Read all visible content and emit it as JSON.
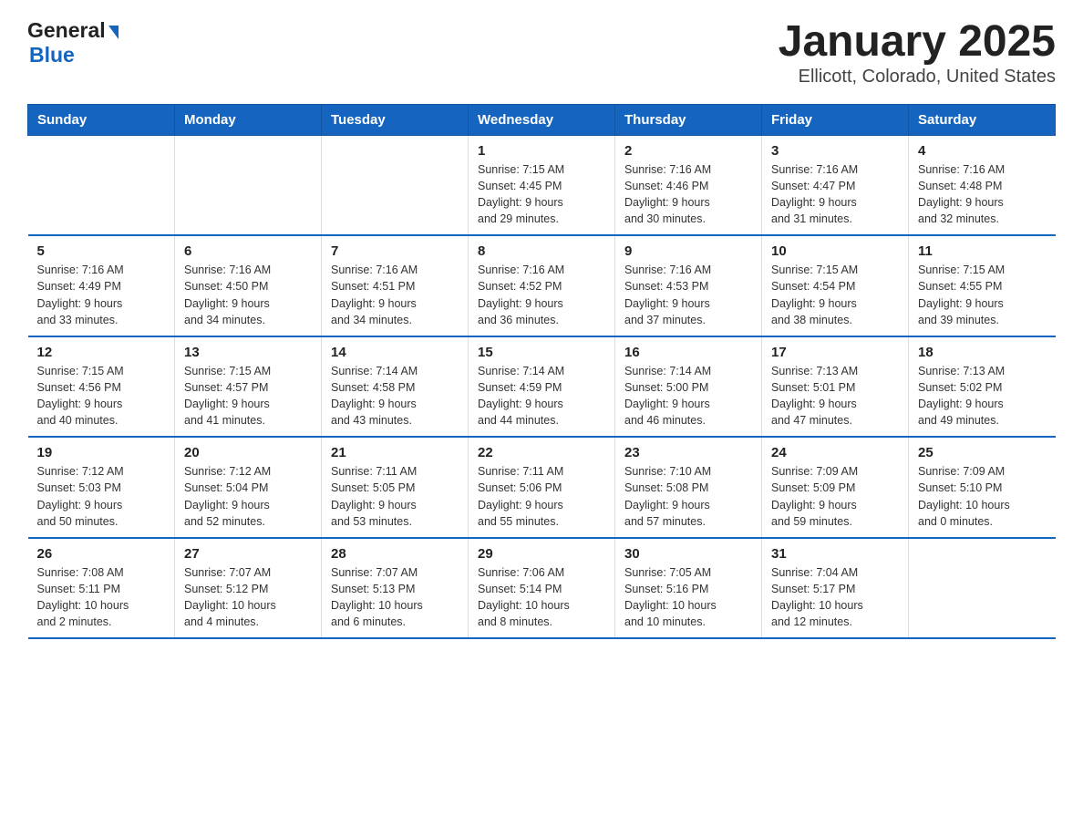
{
  "header": {
    "title": "January 2025",
    "subtitle": "Ellicott, Colorado, United States",
    "logo_general": "General",
    "logo_blue": "Blue"
  },
  "days_of_week": [
    "Sunday",
    "Monday",
    "Tuesday",
    "Wednesday",
    "Thursday",
    "Friday",
    "Saturday"
  ],
  "weeks": [
    [
      {
        "num": "",
        "info": ""
      },
      {
        "num": "",
        "info": ""
      },
      {
        "num": "",
        "info": ""
      },
      {
        "num": "1",
        "info": "Sunrise: 7:15 AM\nSunset: 4:45 PM\nDaylight: 9 hours\nand 29 minutes."
      },
      {
        "num": "2",
        "info": "Sunrise: 7:16 AM\nSunset: 4:46 PM\nDaylight: 9 hours\nand 30 minutes."
      },
      {
        "num": "3",
        "info": "Sunrise: 7:16 AM\nSunset: 4:47 PM\nDaylight: 9 hours\nand 31 minutes."
      },
      {
        "num": "4",
        "info": "Sunrise: 7:16 AM\nSunset: 4:48 PM\nDaylight: 9 hours\nand 32 minutes."
      }
    ],
    [
      {
        "num": "5",
        "info": "Sunrise: 7:16 AM\nSunset: 4:49 PM\nDaylight: 9 hours\nand 33 minutes."
      },
      {
        "num": "6",
        "info": "Sunrise: 7:16 AM\nSunset: 4:50 PM\nDaylight: 9 hours\nand 34 minutes."
      },
      {
        "num": "7",
        "info": "Sunrise: 7:16 AM\nSunset: 4:51 PM\nDaylight: 9 hours\nand 34 minutes."
      },
      {
        "num": "8",
        "info": "Sunrise: 7:16 AM\nSunset: 4:52 PM\nDaylight: 9 hours\nand 36 minutes."
      },
      {
        "num": "9",
        "info": "Sunrise: 7:16 AM\nSunset: 4:53 PM\nDaylight: 9 hours\nand 37 minutes."
      },
      {
        "num": "10",
        "info": "Sunrise: 7:15 AM\nSunset: 4:54 PM\nDaylight: 9 hours\nand 38 minutes."
      },
      {
        "num": "11",
        "info": "Sunrise: 7:15 AM\nSunset: 4:55 PM\nDaylight: 9 hours\nand 39 minutes."
      }
    ],
    [
      {
        "num": "12",
        "info": "Sunrise: 7:15 AM\nSunset: 4:56 PM\nDaylight: 9 hours\nand 40 minutes."
      },
      {
        "num": "13",
        "info": "Sunrise: 7:15 AM\nSunset: 4:57 PM\nDaylight: 9 hours\nand 41 minutes."
      },
      {
        "num": "14",
        "info": "Sunrise: 7:14 AM\nSunset: 4:58 PM\nDaylight: 9 hours\nand 43 minutes."
      },
      {
        "num": "15",
        "info": "Sunrise: 7:14 AM\nSunset: 4:59 PM\nDaylight: 9 hours\nand 44 minutes."
      },
      {
        "num": "16",
        "info": "Sunrise: 7:14 AM\nSunset: 5:00 PM\nDaylight: 9 hours\nand 46 minutes."
      },
      {
        "num": "17",
        "info": "Sunrise: 7:13 AM\nSunset: 5:01 PM\nDaylight: 9 hours\nand 47 minutes."
      },
      {
        "num": "18",
        "info": "Sunrise: 7:13 AM\nSunset: 5:02 PM\nDaylight: 9 hours\nand 49 minutes."
      }
    ],
    [
      {
        "num": "19",
        "info": "Sunrise: 7:12 AM\nSunset: 5:03 PM\nDaylight: 9 hours\nand 50 minutes."
      },
      {
        "num": "20",
        "info": "Sunrise: 7:12 AM\nSunset: 5:04 PM\nDaylight: 9 hours\nand 52 minutes."
      },
      {
        "num": "21",
        "info": "Sunrise: 7:11 AM\nSunset: 5:05 PM\nDaylight: 9 hours\nand 53 minutes."
      },
      {
        "num": "22",
        "info": "Sunrise: 7:11 AM\nSunset: 5:06 PM\nDaylight: 9 hours\nand 55 minutes."
      },
      {
        "num": "23",
        "info": "Sunrise: 7:10 AM\nSunset: 5:08 PM\nDaylight: 9 hours\nand 57 minutes."
      },
      {
        "num": "24",
        "info": "Sunrise: 7:09 AM\nSunset: 5:09 PM\nDaylight: 9 hours\nand 59 minutes."
      },
      {
        "num": "25",
        "info": "Sunrise: 7:09 AM\nSunset: 5:10 PM\nDaylight: 10 hours\nand 0 minutes."
      }
    ],
    [
      {
        "num": "26",
        "info": "Sunrise: 7:08 AM\nSunset: 5:11 PM\nDaylight: 10 hours\nand 2 minutes."
      },
      {
        "num": "27",
        "info": "Sunrise: 7:07 AM\nSunset: 5:12 PM\nDaylight: 10 hours\nand 4 minutes."
      },
      {
        "num": "28",
        "info": "Sunrise: 7:07 AM\nSunset: 5:13 PM\nDaylight: 10 hours\nand 6 minutes."
      },
      {
        "num": "29",
        "info": "Sunrise: 7:06 AM\nSunset: 5:14 PM\nDaylight: 10 hours\nand 8 minutes."
      },
      {
        "num": "30",
        "info": "Sunrise: 7:05 AM\nSunset: 5:16 PM\nDaylight: 10 hours\nand 10 minutes."
      },
      {
        "num": "31",
        "info": "Sunrise: 7:04 AM\nSunset: 5:17 PM\nDaylight: 10 hours\nand 12 minutes."
      },
      {
        "num": "",
        "info": ""
      }
    ]
  ]
}
